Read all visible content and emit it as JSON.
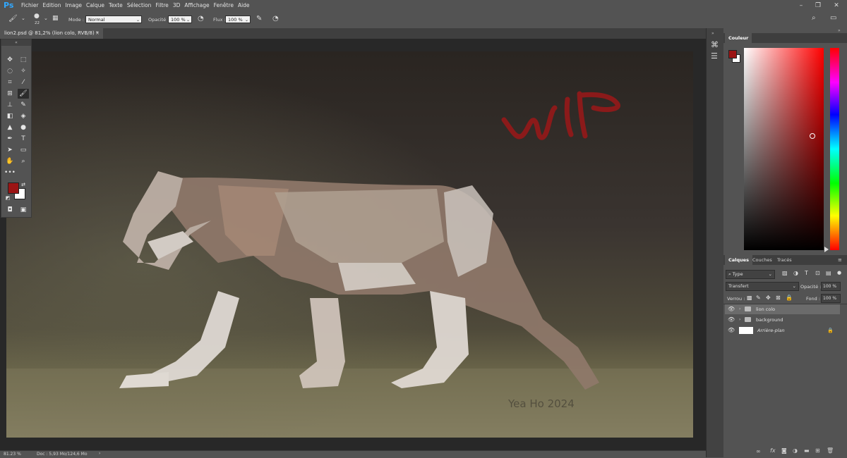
{
  "app": {
    "logo": "Ps"
  },
  "menu": [
    "Fichier",
    "Edition",
    "Image",
    "Calque",
    "Texte",
    "Sélection",
    "Filtre",
    "3D",
    "Affichage",
    "Fenêtre",
    "Aide"
  ],
  "options": {
    "brush_size": "22",
    "mode_label": "Mode :",
    "mode_value": "Normal",
    "opacity_label": "Opacité :",
    "opacity_value": "100 %",
    "flow_label": "Flux :",
    "flow_value": "100 %"
  },
  "document": {
    "tab_title": "lion2.psd @ 81,2% (lion colo, RVB/8) *",
    "close_symbol": "×",
    "canvas_text": "Yea Ho 2024",
    "canvas_wip_color": "#8b1a1a"
  },
  "status": {
    "zoom": "81.23 %",
    "doc_info": "Doc : 5,93 Mo/124,6 Mo",
    "arrow": "›"
  },
  "colors": {
    "foreground": "#9b1414",
    "background": "#ffffff",
    "accent": "#31a8ff"
  },
  "color_panel": {
    "tab": "Couleur"
  },
  "layers_panel": {
    "tabs": [
      "Calques",
      "Couches",
      "Tracés"
    ],
    "filter": "Type",
    "blend_mode": "Transfert",
    "opacity_label": "Opacité :",
    "opacity_value": "100 %",
    "lock_label": "Verrou :",
    "fill_label": "Fond :",
    "fill_value": "100 %",
    "layers": [
      {
        "name": "lion colo",
        "type": "group",
        "selected": true
      },
      {
        "name": "background",
        "type": "group",
        "selected": false
      },
      {
        "name": "Arrière-plan",
        "type": "image",
        "selected": false,
        "locked": true
      }
    ],
    "footer_fx": "fx"
  }
}
